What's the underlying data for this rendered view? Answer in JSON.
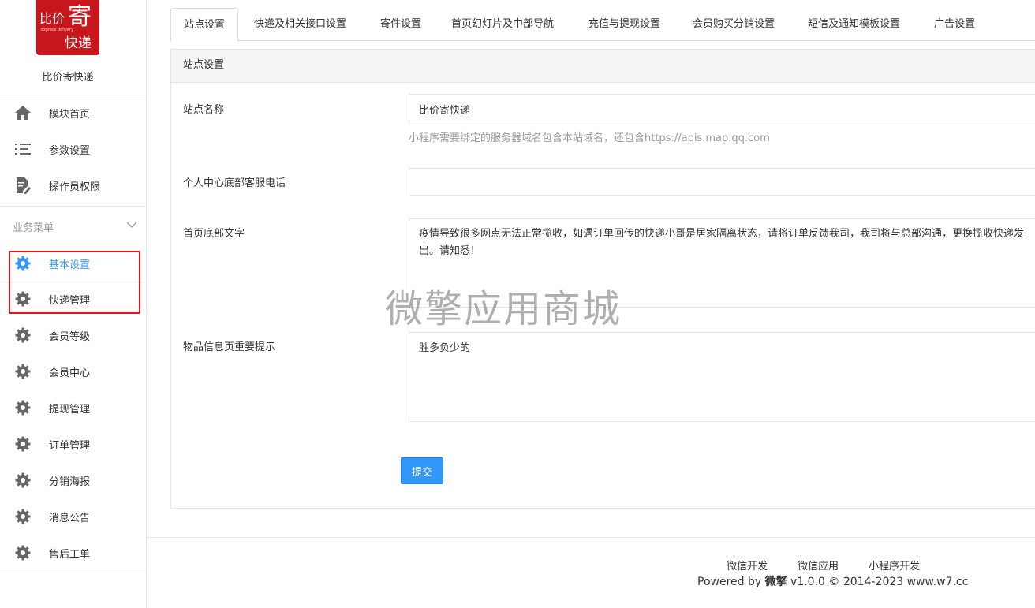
{
  "brand": {
    "logo_text_1": "比价",
    "logo_text_2": "寄",
    "logo_text_3": "express delivery",
    "logo_text_4": "快递",
    "name": "比价寄快递"
  },
  "sidebar": {
    "top_items": [
      {
        "label": "模块首页",
        "icon": "home-icon"
      },
      {
        "label": "参数设置",
        "icon": "list-icon"
      },
      {
        "label": "操作员权限",
        "icon": "document-edit-icon"
      }
    ],
    "section_label": "业务菜单",
    "menu_items": [
      {
        "label": "基本设置",
        "icon": "gear-icon",
        "active": true
      },
      {
        "label": "快递管理",
        "icon": "gear-icon"
      },
      {
        "label": "会员等级",
        "icon": "gear-icon"
      },
      {
        "label": "会员中心",
        "icon": "gear-icon"
      },
      {
        "label": "提现管理",
        "icon": "gear-icon"
      },
      {
        "label": "订单管理",
        "icon": "gear-icon"
      },
      {
        "label": "分销海报",
        "icon": "gear-icon"
      },
      {
        "label": "消息公告",
        "icon": "gear-icon"
      },
      {
        "label": "售后工单",
        "icon": "gear-icon"
      }
    ]
  },
  "tabs": [
    "站点设置",
    "快递及相关接口设置",
    "寄件设置",
    "首页幻灯片及中部导航",
    "充值与提现设置",
    "会员购买分销设置",
    "短信及通知模板设置",
    "广告设置"
  ],
  "panel": {
    "title": "站点设置",
    "fields": {
      "site_name": {
        "label": "站点名称",
        "value": "比价寄快递",
        "hint": "小程序需要绑定的服务器域名包含本站域名，还包含https://apis.map.qq.com"
      },
      "service_phone": {
        "label": "个人中心底部客服电话",
        "value": ""
      },
      "footer_text": {
        "label": "首页底部文字",
        "value": "疫情导致很多网点无法正常揽收，如遇订单回传的快递小哥是居家隔离状态，请将订单反馈我司，我司将与总部沟通，更换揽收快递发出。请知悉！"
      },
      "goods_tip": {
        "label": "物品信息页重要提示",
        "value": "胜多负少的"
      }
    },
    "submit_label": "提交"
  },
  "watermark": "微擎应用商城",
  "footer": {
    "links": [
      "微信开发",
      "微信应用",
      "小程序开发"
    ],
    "powered_prefix": "Powered by ",
    "powered_brand": "微擎",
    "powered_suffix": " v1.0.0 © 2014-2023 www.w7.cc"
  },
  "colors": {
    "accent": "#3296fa",
    "brand": "#c8161d",
    "highlight_box": "#e3141b"
  }
}
